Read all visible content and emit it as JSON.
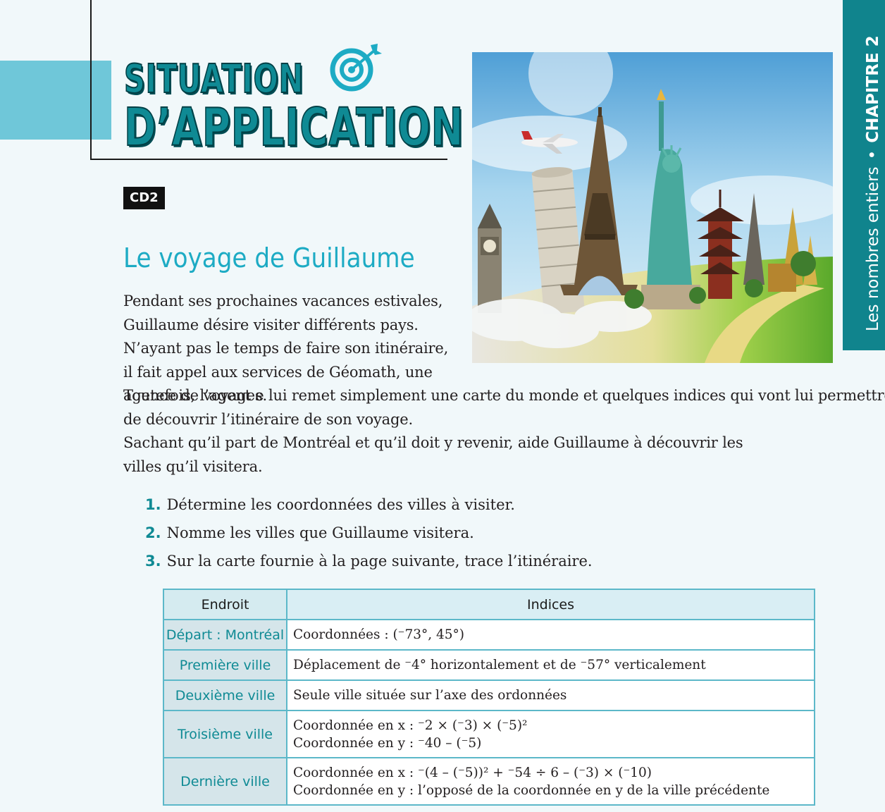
{
  "header": {
    "title_line1": "SITUATION",
    "title_line2": "D’APPLICATION",
    "badge": "CD2",
    "subtitle": "Le voyage de Guillaume"
  },
  "side_tab": {
    "chapter": "Les nombres entiers",
    "separator": "•",
    "label": "CHAPITRE 2"
  },
  "photo": {
    "alt_icons": [
      "eiffel-tower",
      "leaning-tower-of-pisa",
      "statue-of-liberty",
      "big-ben",
      "pagoda",
      "airplane"
    ]
  },
  "intro": {
    "p1": "Pendant ses prochaines vacances estivales, Guillaume désire visiter différents pays. N’ayant pas le temps de faire son itinéraire, il fait appel aux services de Géomath, une agence de voyages.",
    "p2_line1": "Toutefois, l’agent e lui remet simplement une carte du monde et quelques indices qui vont lui permettre",
    "p2_line2": "de découvrir l’itinéraire de son voyage.",
    "p3": "Sachant qu’il part de Montréal et qu’il doit y revenir, aide Guillaume à découvrir les villes qu’il visitera."
  },
  "questions": [
    {
      "num": "1.",
      "text": "Détermine les coordonnées des villes à visiter."
    },
    {
      "num": "2.",
      "text": "Nomme les villes que Guillaume visitera."
    },
    {
      "num": "3.",
      "text": "Sur la carte fournie à la page suivante, trace l’itinéraire."
    }
  ],
  "table": {
    "headers": [
      "Endroit",
      "Indices"
    ],
    "rows": [
      {
        "place": "Départ : Montréal",
        "clue1": "Coordonnées : (⁻73°, 45°)",
        "clue2": ""
      },
      {
        "place": "Première ville",
        "clue1": "Déplacement de ⁻4° horizontalement et de ⁻57° verticalement",
        "clue2": ""
      },
      {
        "place": "Deuxième ville",
        "clue1": "Seule ville située sur l’axe des ordonnées",
        "clue2": ""
      },
      {
        "place": "Troisième ville",
        "clue1": "Coordonnée en x : ⁻2 × (⁻3) × (⁻5)²",
        "clue2": "Coordonnée en y : ⁻40 – (⁻5)"
      },
      {
        "place": "Dernière ville",
        "clue1": "Coordonnée en x : ⁻(4 – (⁻5))² + ⁻54 ÷ 6 – (⁻3) × (⁻10)",
        "clue2": "Coordonnée en y : l’opposé de la coordonnée en y de la ville précédente"
      }
    ]
  },
  "colors": {
    "accent": "#0f8a94",
    "light_accent": "#6fc7d9",
    "title_blue": "#1dabc4",
    "background": "#f1f8fa"
  }
}
